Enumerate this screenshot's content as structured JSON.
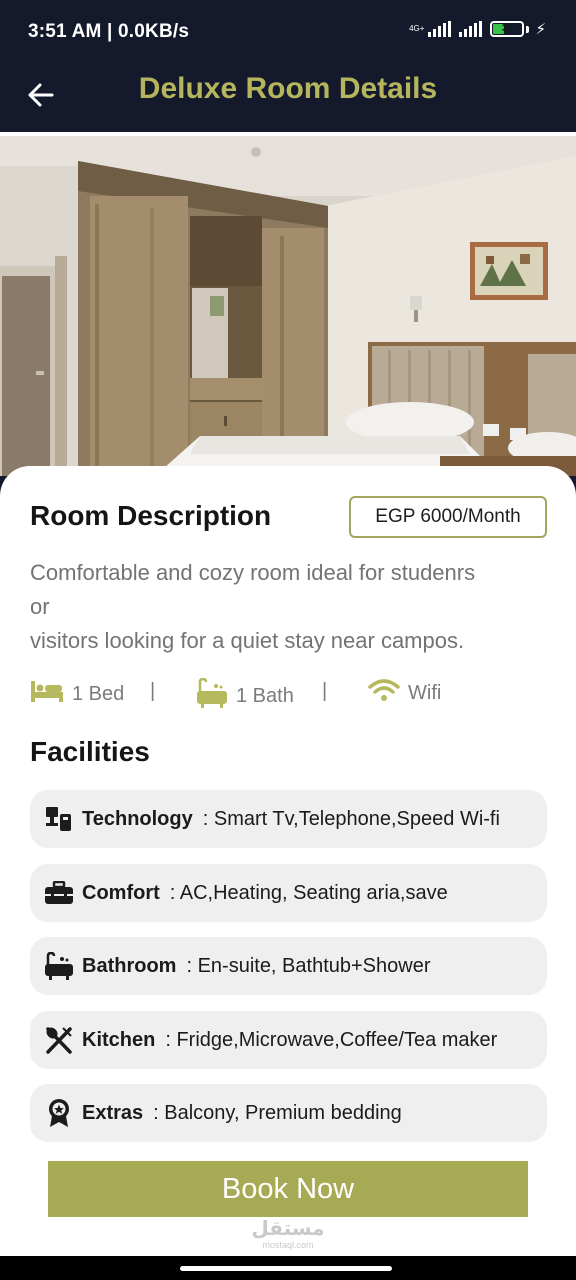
{
  "status_bar": {
    "time_speed": "3:51 AM | 0.0KB/s",
    "network": "4G+",
    "battery": "37"
  },
  "app_bar": {
    "title": "Deluxe Room Details",
    "back_icon": "arrow-left-icon"
  },
  "room": {
    "description_heading": "Room Description",
    "price": "EGP 6000/Month",
    "description_lines": [
      "Comfortable and cozy room ideal for studenrs",
      "or",
      "visitors looking for a quiet stay near campos."
    ],
    "features": [
      {
        "icon": "bed-icon",
        "label": "1 Bed"
      },
      {
        "icon": "bathtub-icon",
        "label": "1 Bath"
      },
      {
        "icon": "wifi-icon",
        "label": "Wifi"
      }
    ],
    "separator": "|"
  },
  "facilities": {
    "heading": "Facilities",
    "items": [
      {
        "icon": "devices-icon",
        "name": "Technology",
        "value": ": Smart Tv,Telephone,Speed Wi-fi"
      },
      {
        "icon": "toolbox-icon",
        "name": "Comfort",
        "value": ": AC,Heating, Seating aria,save"
      },
      {
        "icon": "bathtub-icon",
        "name": "Bathroom",
        "value": ": En-suite, Bathtub+Shower"
      },
      {
        "icon": "utensils-icon",
        "name": "Kitchen",
        "value": ": Fridge,Microwave,Coffee/Tea maker"
      },
      {
        "icon": "award-icon",
        "name": "Extras",
        "value": ": Balcony, Premium bedding"
      }
    ]
  },
  "book_button": "Book Now",
  "watermark": {
    "arabic": "مستقل",
    "latin": "mostaql.com"
  },
  "colors": {
    "header_bg": "#141a2c",
    "title_accent": "#b5b55e",
    "icon_accent": "#a3a65b",
    "button_bg": "#a6aa55",
    "card_bg": "#efefef"
  }
}
